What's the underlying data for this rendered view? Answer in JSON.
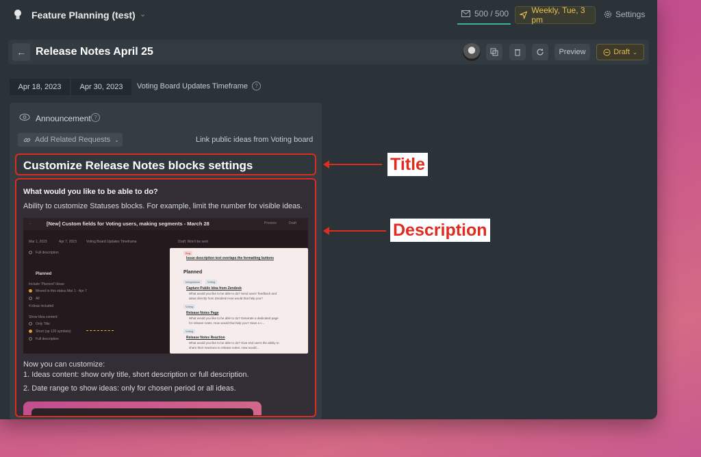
{
  "workspace": {
    "title": "Feature Planning (test)"
  },
  "topbar": {
    "mail_count": "500 / 500",
    "schedule": "Weekly, Tue, 3 pm",
    "settings_label": "Settings"
  },
  "header": {
    "title": "Release Notes April 25",
    "preview_label": "Preview",
    "status_label": "Draft"
  },
  "dates": {
    "start": "Apr 18, 2023",
    "end": "Apr 30, 2023",
    "label": "Voting Board Updates Timeframe"
  },
  "panel": {
    "announcement_label": "Announcement",
    "add_related_label": "Add Related Requests",
    "link_public_label": "Link public ideas from Voting board",
    "item_title": "Customize Release Notes blocks settings",
    "description": {
      "question": "What would you like to be able to do?",
      "intro": "Ability to customize Statuses blocks. For example, limit the number for visible ideas.",
      "sub_heading": "Now you can customize:",
      "list": [
        "1. Ideas content: show only title, short description or full description.",
        "2.  Date range to show ideas: only for chosen period or all ideas."
      ]
    },
    "embedded_shot": {
      "title": "[New] Custom fields for Voting users, making segments - March 28",
      "preview": "Preview",
      "draft": "Draft",
      "date1": "Mar 1, 2023",
      "date2": "Apr 7, 2023",
      "timeframe": "Voting Board Updates Timeframe",
      "draft_note": "Draft: Won't be sent",
      "full_description": "Full description",
      "planned": "Planned",
      "include_planned": "Include 'Planned' Ideas:",
      "opt_moved": "Moved to this status Mar 1 - Apr 7",
      "opt_all": "All",
      "ideas_included": "4 ideas included",
      "show_content": "Show Idea content:",
      "opt_only_title": "Only Title",
      "opt_short": "Short (up 120 symbols)",
      "opt_full": "Full description",
      "card": {
        "bug_tag": "Bug",
        "bug_link": "Issue description text overlaps the formatting buttons",
        "heading": "Planned",
        "tags1": [
          "Integrations",
          "Voting"
        ],
        "item1_link": "Capture Public Idea from Zendesk",
        "item1_text_a": "What would you like to be able to do? Send users' feedback and",
        "item1_text_b": "ideas directly from Zendesk How would that help you?",
        "tag2": "Voting",
        "item2_link": "Release Notes Page",
        "item2_text_a": "What would you like to be able to do? Generate a dedicated page",
        "item2_text_b": "for release notes. How would that help you? Have a c...",
        "tag3": "Voting",
        "item3_link": "Release Notes Reaction",
        "item3_text_a": "What would you like to be able to do? Give end users the ability to",
        "item3_text_b": "share their reactions to release notes. How would..."
      }
    }
  },
  "annotations": {
    "title_callout": "Title",
    "description_callout": "Description"
  },
  "colors": {
    "accent_red": "#e02b20",
    "draft_yellow": "#e8b84a",
    "mail_underline": "#36b39a",
    "background_pink": "#c34f8c"
  },
  "icons": [
    "lightbulb-icon",
    "chevron-down-icon",
    "mail-icon",
    "send-icon",
    "gear-icon",
    "arrow-left-icon",
    "copy-icon",
    "trash-icon",
    "refresh-icon",
    "minus-circle-icon",
    "help-icon",
    "eye-icon",
    "link-icon"
  ]
}
